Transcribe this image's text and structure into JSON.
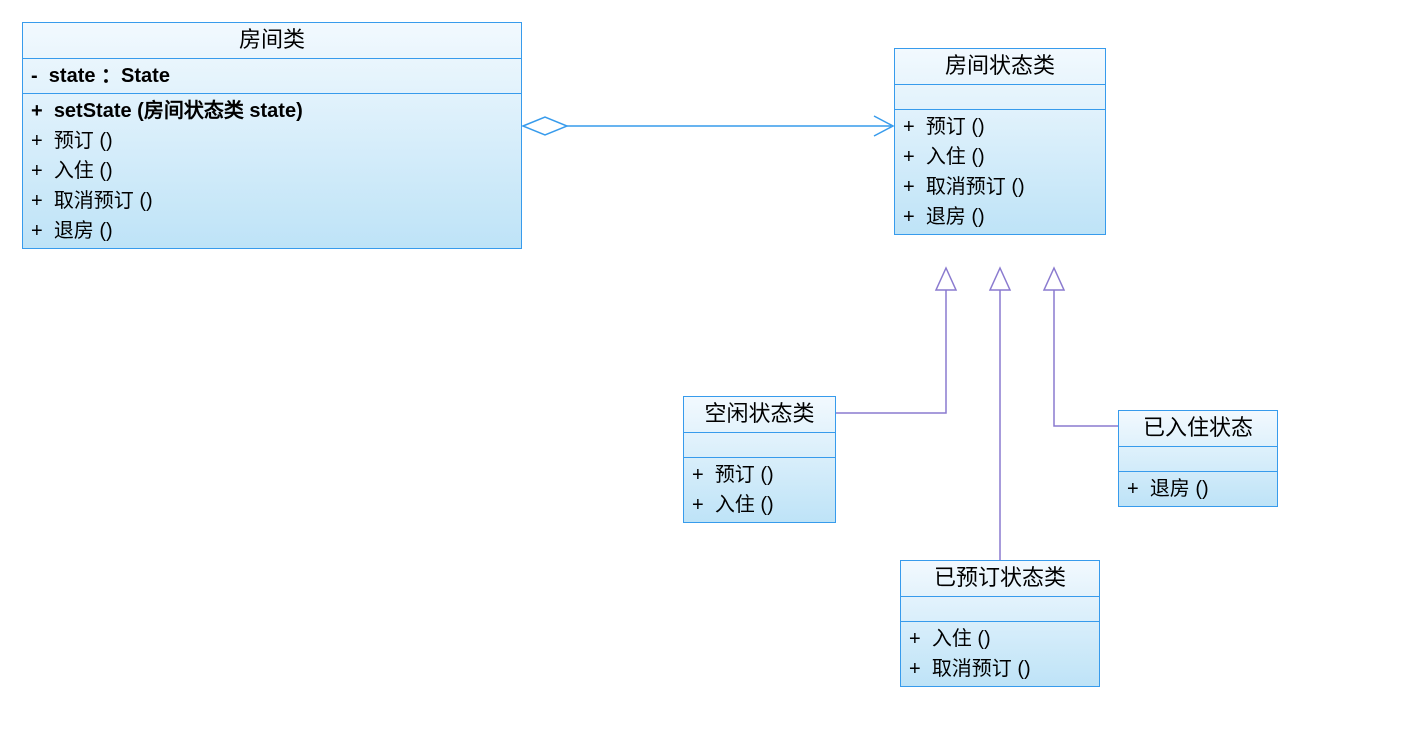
{
  "diagram": {
    "classes": {
      "room": {
        "title": "房间类",
        "attributes": [
          {
            "vis": "-",
            "text": "state ：State",
            "bold": true
          }
        ],
        "operations": [
          {
            "vis": "+",
            "text": "setState (房间状态类 state)",
            "bold": true
          },
          {
            "vis": "+",
            "text": "预订 ()"
          },
          {
            "vis": "+",
            "text": "入住 ()"
          },
          {
            "vis": "+",
            "text": "取消预订 ()"
          },
          {
            "vis": "+",
            "text": "退房 ()"
          }
        ]
      },
      "state": {
        "title": "房间状态类",
        "operations": [
          {
            "vis": "+",
            "text": "预订 ()"
          },
          {
            "vis": "+",
            "text": "入住 ()"
          },
          {
            "vis": "+",
            "text": "取消预订 ()"
          },
          {
            "vis": "+",
            "text": "退房 ()"
          }
        ]
      },
      "idle": {
        "title": "空闲状态类",
        "operations": [
          {
            "vis": "+",
            "text": "预订 ()"
          },
          {
            "vis": "+",
            "text": "入住 ()"
          }
        ]
      },
      "booked": {
        "title": "已预订状态类",
        "operations": [
          {
            "vis": "+",
            "text": "入住 ()"
          },
          {
            "vis": "+",
            "text": "取消预订 ()"
          }
        ]
      },
      "occupied": {
        "title": "已入住状态",
        "operations": [
          {
            "vis": "+",
            "text": "退房 ()"
          }
        ]
      }
    },
    "relationships": [
      {
        "type": "aggregation-arrow",
        "from": "room",
        "to": "state"
      },
      {
        "type": "generalization",
        "from": "idle",
        "to": "state"
      },
      {
        "type": "generalization",
        "from": "booked",
        "to": "state"
      },
      {
        "type": "generalization",
        "from": "occupied",
        "to": "state"
      }
    ]
  }
}
